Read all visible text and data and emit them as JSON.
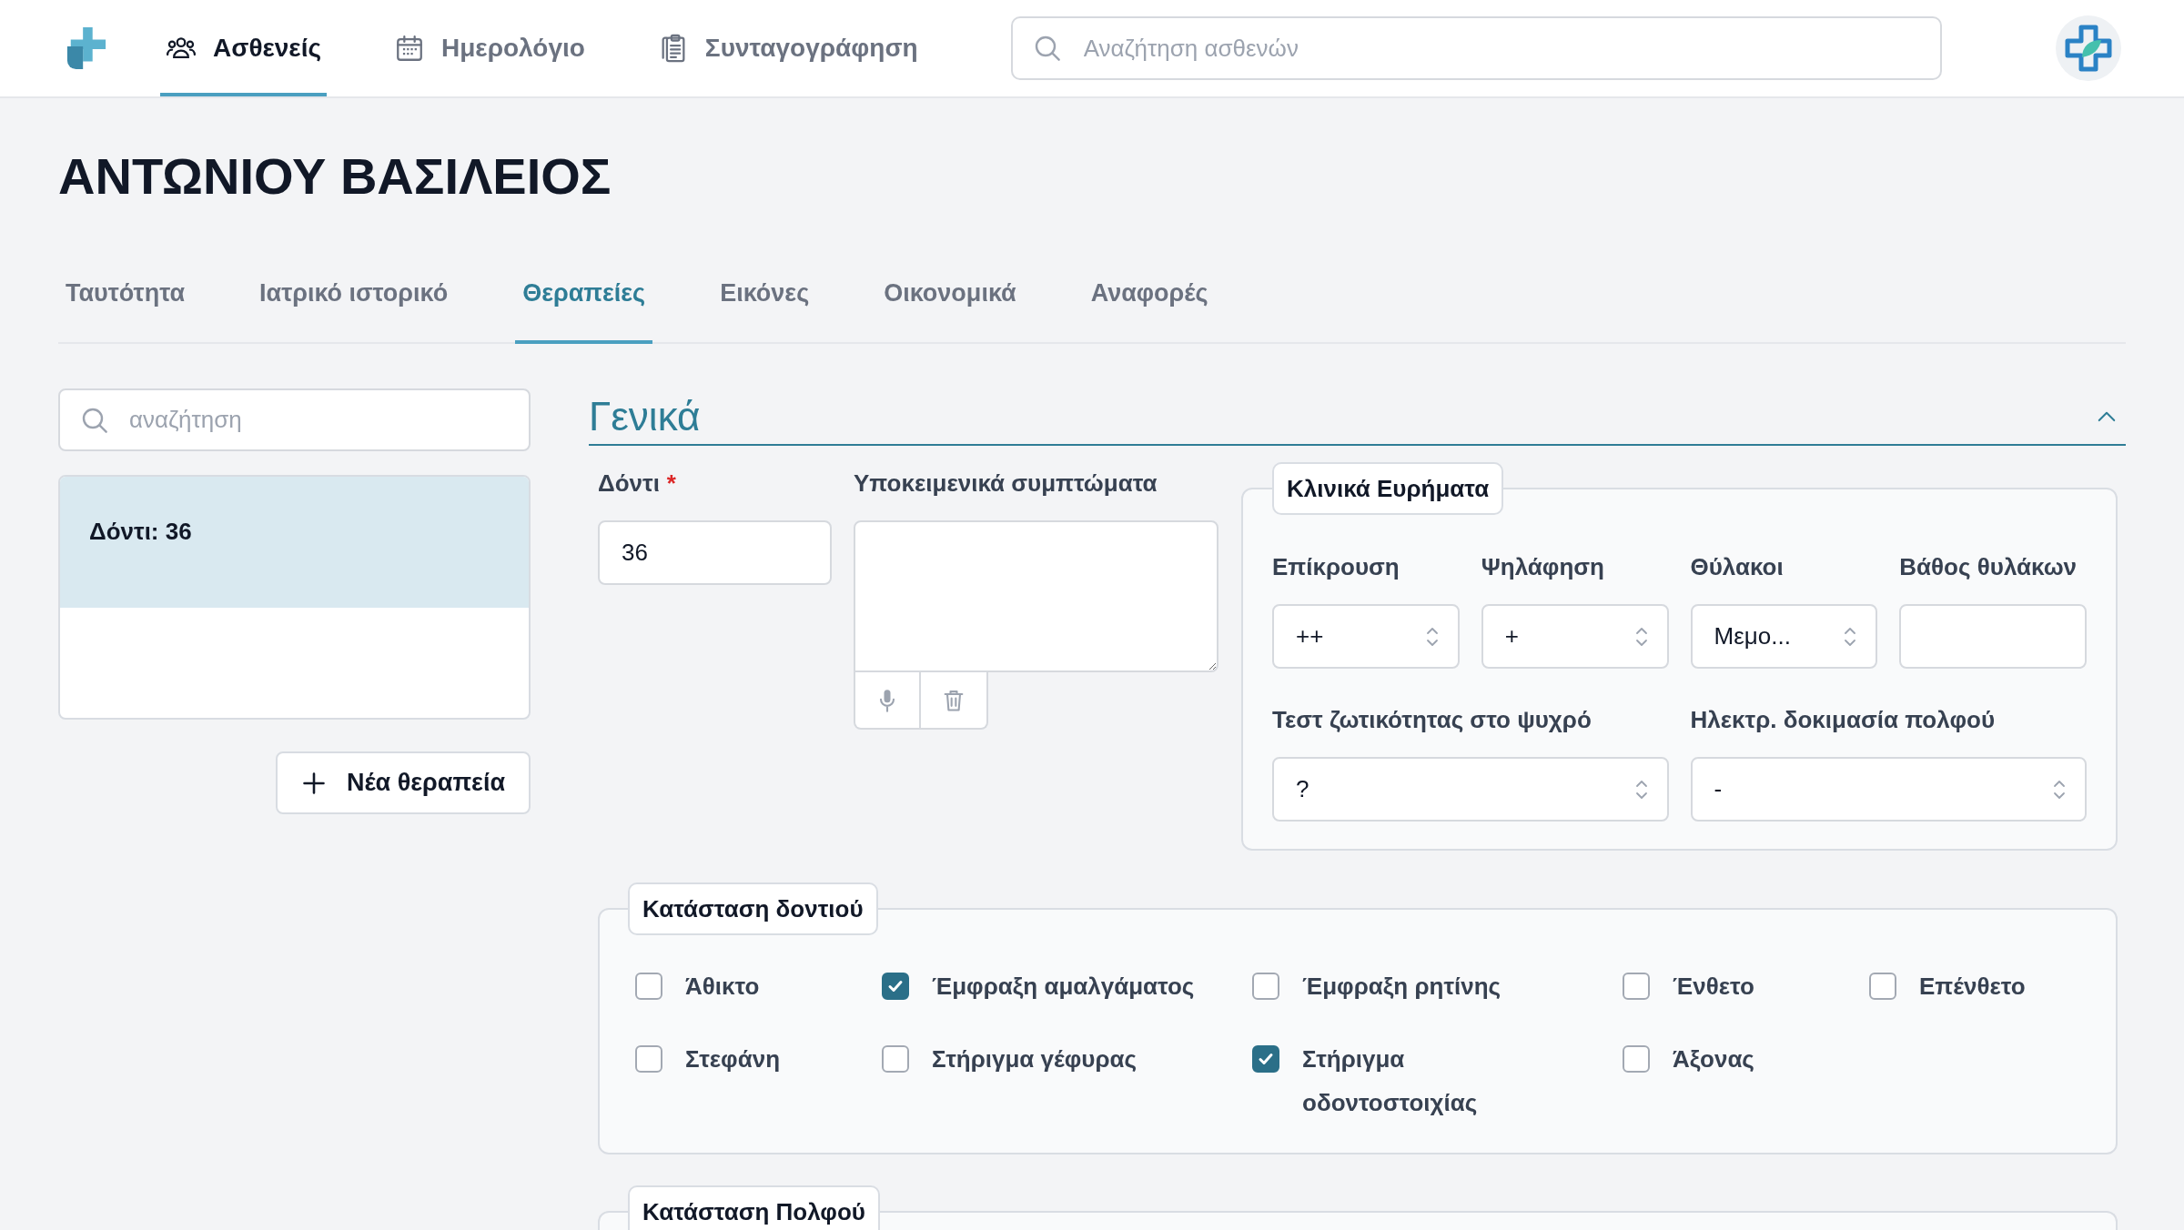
{
  "nav": {
    "items": [
      {
        "label": "Ασθενείς",
        "selected": true
      },
      {
        "label": "Ημερολόγιο",
        "selected": false
      },
      {
        "label": "Συνταγογράφηση",
        "selected": false
      }
    ],
    "search": {
      "placeholder": "Αναζήτηση ασθενών"
    }
  },
  "patient": {
    "name": "ΑΝΤΩΝΙΟΥ ΒΑΣΙΛΕΙΟΣ"
  },
  "tabs": [
    {
      "label": "Ταυτότητα",
      "selected": false
    },
    {
      "label": "Ιατρικό ιστορικό",
      "selected": false
    },
    {
      "label": "Θεραπείες",
      "selected": true
    },
    {
      "label": "Εικόνες",
      "selected": false
    },
    {
      "label": "Οικονομικά",
      "selected": false
    },
    {
      "label": "Αναφορές",
      "selected": false
    }
  ],
  "sidebar": {
    "search": {
      "placeholder": "αναζήτηση"
    },
    "items": [
      {
        "label": "Δόντι: 36",
        "selected": true
      }
    ],
    "new_button": {
      "label": "Νέα θεραπεία"
    }
  },
  "general": {
    "title": "Γενικά",
    "expanded": true,
    "tooth": {
      "label": "Δόντι",
      "required_mark": "*",
      "value": "36"
    },
    "symptoms": {
      "label": "Υποκειμενικά συμπτώματα"
    },
    "clinical": {
      "title": "Κλινικά Ευρήματα",
      "rows": [
        {
          "fields": [
            {
              "label": "Επίκρουση",
              "kind": "select",
              "value": "++"
            },
            {
              "label": "Ψηλάφηση",
              "kind": "select",
              "value": "+"
            },
            {
              "label": "Θύλακοι",
              "kind": "select",
              "value": "Μεμο..."
            },
            {
              "label": "Βάθος θυλάκων",
              "kind": "input"
            }
          ]
        },
        {
          "fields": [
            {
              "label": "Τεστ ζωτικότητας στο ψυχρό",
              "kind": "select",
              "value": "?"
            },
            {
              "label": "Ηλεκτρ. δοκιμασία πολφού",
              "kind": "select",
              "value": "-"
            }
          ]
        }
      ]
    }
  },
  "tooth_status": {
    "title": "Κατάσταση δοντιού",
    "options": [
      {
        "label": "Άθικτο",
        "checked": false
      },
      {
        "label": "Έμφραξη αμαλγάματος",
        "checked": true
      },
      {
        "label": "Έμφραξη ρητίνης",
        "checked": false
      },
      {
        "label": "Ένθετο",
        "checked": false
      },
      {
        "label": "Επένθετο",
        "checked": false
      },
      {
        "label": "Στεφάνη",
        "checked": false
      },
      {
        "label": "Στήριγμα γέφυρας",
        "checked": false
      },
      {
        "label": "Στήριγμα οδοντοστοιχίας",
        "checked": true
      },
      {
        "label": "Άξονας",
        "checked": false
      }
    ]
  },
  "pulp_status": {
    "title": "Κατάσταση Πολφού"
  }
}
